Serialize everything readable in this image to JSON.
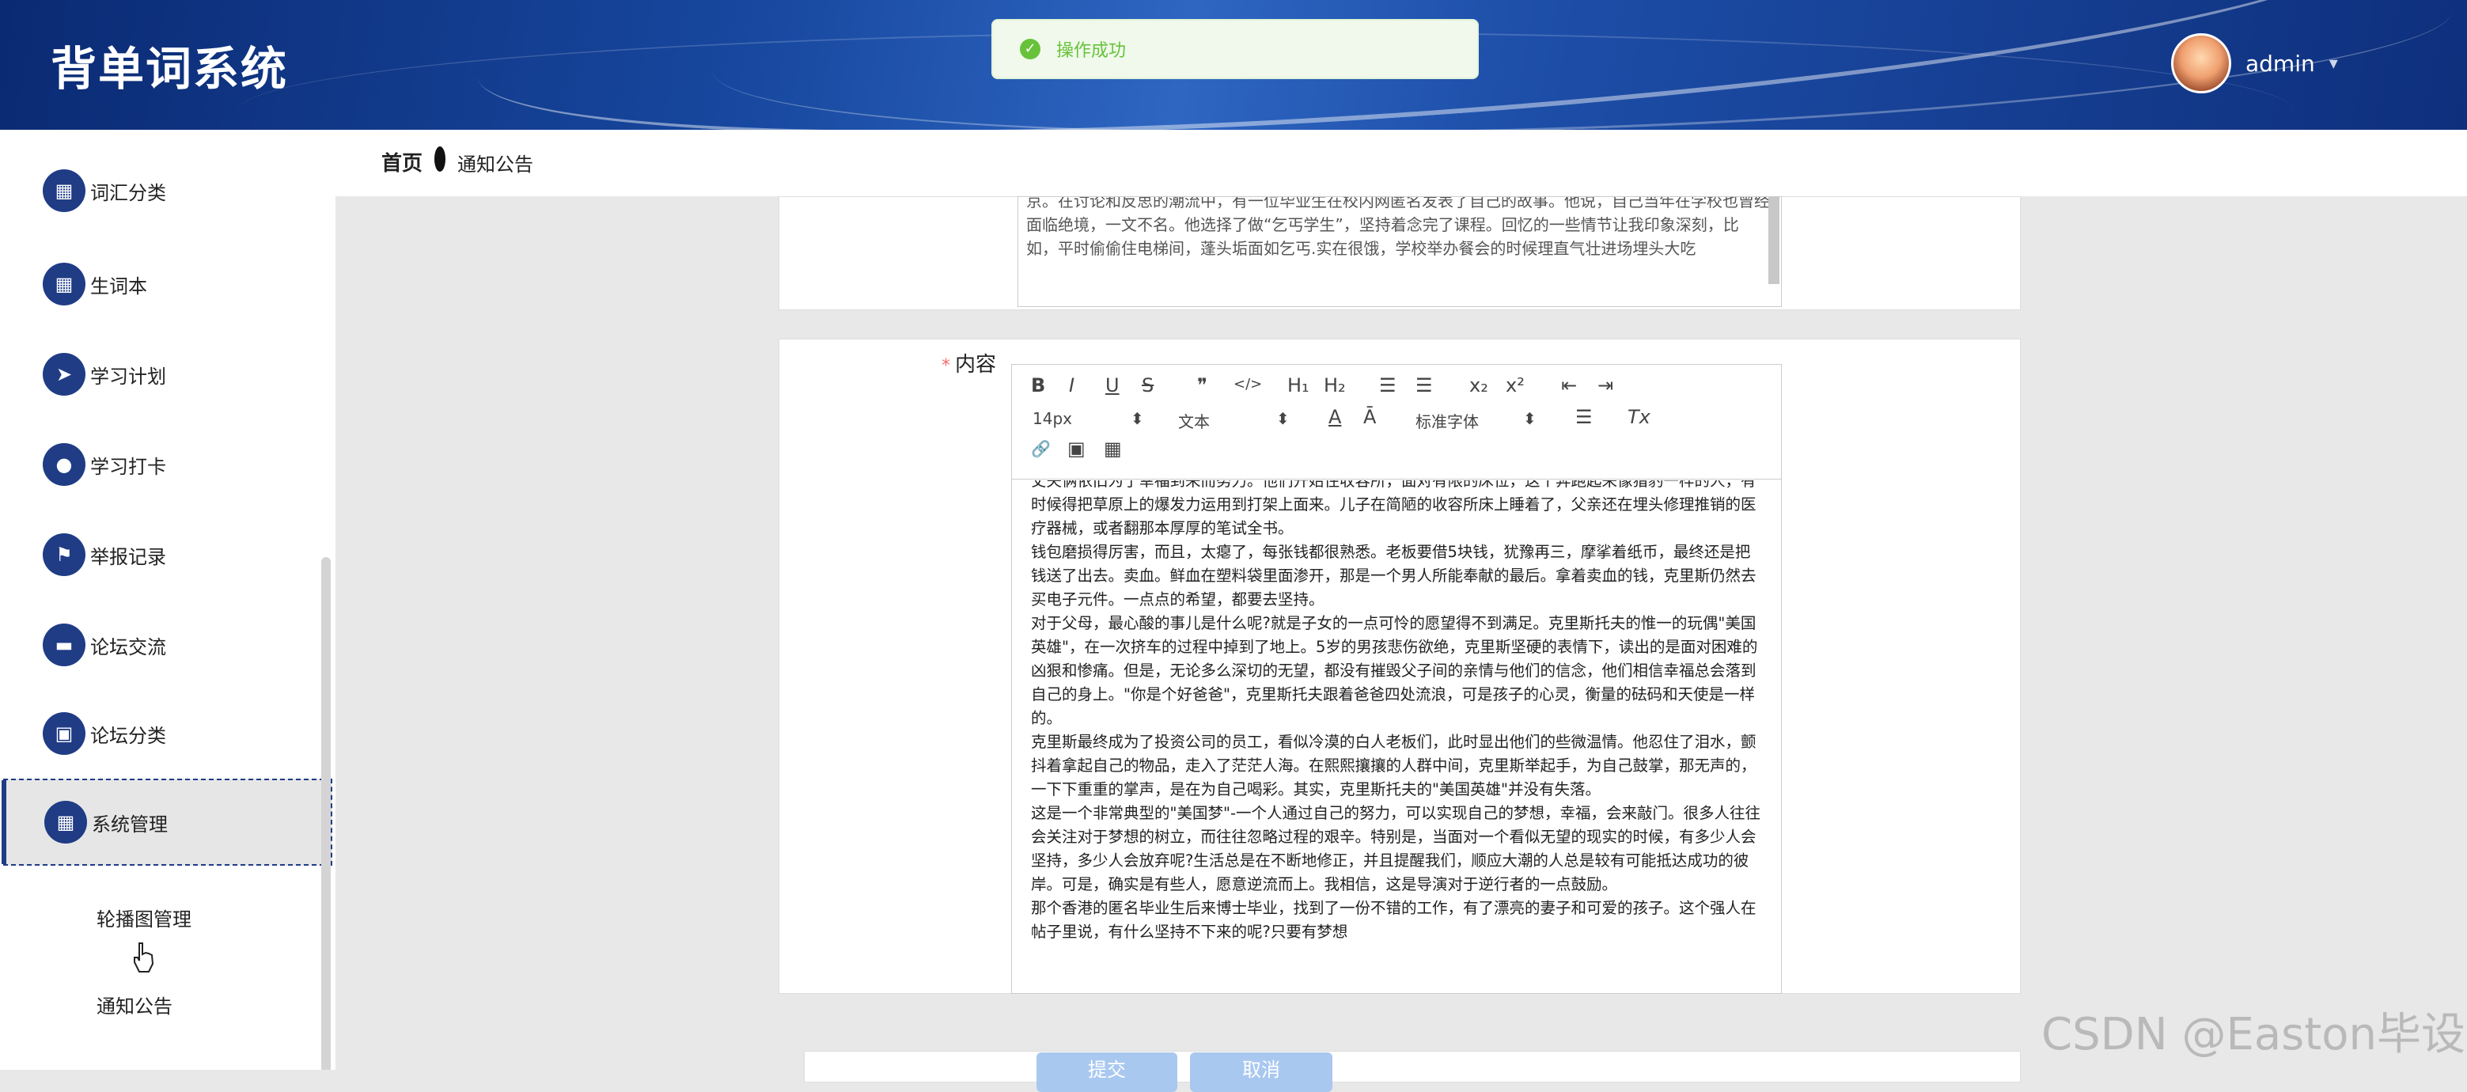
{
  "header": {
    "app_title": "背单词系统",
    "username": "admin",
    "caret": "▾"
  },
  "toast": {
    "icon": "✓",
    "message": "操作成功"
  },
  "sidebar": {
    "items": [
      {
        "label": "词汇分类",
        "icon": "▦"
      },
      {
        "label": "生词本",
        "icon": "▦"
      },
      {
        "label": "学习计划",
        "icon": "➤"
      },
      {
        "label": "学习打卡",
        "icon": "●"
      },
      {
        "label": "举报记录",
        "icon": "⚑"
      },
      {
        "label": "论坛交流",
        "icon": "▬"
      },
      {
        "label": "论坛分类",
        "icon": "▣"
      },
      {
        "label": "系统管理",
        "icon": "▦"
      }
    ],
    "submenu": [
      {
        "label": "轮播图管理"
      },
      {
        "label": "通知公告"
      }
    ]
  },
  "breadcrumb": {
    "home": "首页",
    "current": "通知公告"
  },
  "form": {
    "summary_text": "京。在讨论和反思的潮流中，有一位毕业生在校内网匿名发表了自己的故事。他说，自己当年在学校也曾经面临绝境，一文不名。他选择了做“乞丐学生”，坚持着念完了课程。回忆的一些情节让我印象深刻，比如，平时偷偷住电梯间，蓬头垢面如乞丐.实在很饿，学校举办餐会的时候理直气壮进场埋头大吃",
    "content_label": "内容",
    "required_star": "*",
    "toolbar": {
      "font_size": "14px",
      "text_style": "文本",
      "font_family": "标准字体",
      "bold": "B",
      "italic": "I",
      "underline": "U",
      "strike": "S",
      "quote": "❞",
      "code": "</>",
      "h1": "H₁",
      "h2": "H₂",
      "ol": "☰",
      "ul": "☰",
      "sub": "x₂",
      "sup": "x²",
      "outdent": "⇤",
      "indent": "⇥",
      "color": "A",
      "bg": "Ā",
      "align": "☰",
      "clean": "Tx",
      "link": "🔗",
      "image": "▣",
      "video": "▦"
    },
    "paragraphs": [
      "丈夫俩依旧为了幸福到来而努力。他们开始住收容所，面对有限的床位，这个奔跑起来像猎豹一样的人，有时候得把草原上的爆发力运用到打架上面来。儿子在简陋的收容所床上睡着了，父亲还在埋头修理推销的医疗器械，或者翻那本厚厚的笔试全书。",
      "钱包磨损得厉害，而且，太瘪了，每张钱都很熟悉。老板要借5块钱，犹豫再三，摩挲着纸币，最终还是把钱送了出去。卖血。鲜血在塑料袋里面渗开，那是一个男人所能奉献的最后。拿着卖血的钱，克里斯仍然去买电子元件。一点点的希望，都要去坚持。",
      "对于父母，最心酸的事儿是什么呢?就是子女的一点可怜的愿望得不到满足。克里斯托夫的惟一的玩偶\"美国英雄\"，在一次挤车的过程中掉到了地上。5岁的男孩悲伤欲绝，克里斯坚硬的表情下，读出的是面对困难的凶狠和惨痛。但是，无论多么深切的无望，都没有摧毁父子间的亲情与他们的信念，他们相信幸福总会落到自己的身上。\"你是个好爸爸\"，克里斯托夫跟着爸爸四处流浪，可是孩子的心灵，衡量的砝码和天使是一样的。",
      "克里斯最终成为了投资公司的员工，看似冷漠的白人老板们，此时显出他们的些微温情。他忍住了泪水，颤抖着拿起自己的物品，走入了茫茫人海。在熙熙攘攘的人群中间，克里斯举起手，为自己鼓掌，那无声的，一下下重重的掌声，是在为自己喝彩。其实，克里斯托夫的\"美国英雄\"并没有失落。",
      "这是一个非常典型的\"美国梦\"-一个人通过自己的努力，可以实现自己的梦想，幸福，会来敲门。很多人往往会关注对于梦想的树立，而往往忽略过程的艰辛。特别是，当面对一个看似无望的现实的时候，有多少人会坚持，多少人会放弃呢?生活总是在不断地修正，并且提醒我们，顺应大潮的人总是较有可能抵达成功的彼岸。可是，确实是有些人，愿意逆流而上。我相信，这是导演对于逆行者的一点鼓励。",
      "那个香港的匿名毕业生后来博士毕业，找到了一份不错的工作，有了漂亮的妻子和可爱的孩子。这个强人在帖子里说，有什么坚持不下来的呢?只要有梦想"
    ],
    "submit_label": "提交",
    "cancel_label": "取消"
  },
  "watermark": "CSDN @Easton毕设"
}
